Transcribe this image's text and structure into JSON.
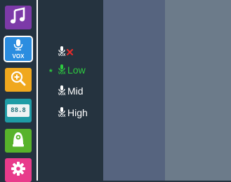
{
  "colors": {
    "sidebar_bg": "#24323f",
    "submenu_bg": "#25333f",
    "panel_mid": "#56647f",
    "panel_right": "#6c7b8a",
    "selected_green": "#2ecc40",
    "mute_red": "#e32b2b"
  },
  "sidebar": {
    "items": [
      {
        "name": "music",
        "icon": "music-note-icon",
        "color": "#7c3aa8"
      },
      {
        "name": "vox",
        "icon": "microphone-icon",
        "label": "VOX",
        "color": "#2b8de0",
        "active": true
      },
      {
        "name": "zoom",
        "icon": "zoom-in-icon",
        "color": "#f0a81e"
      },
      {
        "name": "temperature",
        "icon": "thermometer-display-icon",
        "value": "88.8",
        "color": "#1f9ca6"
      },
      {
        "name": "camera",
        "icon": "baby-camera-icon",
        "color": "#57b32b"
      },
      {
        "name": "settings",
        "icon": "gear-icon",
        "color": "#e83b8b"
      }
    ]
  },
  "vox_menu": {
    "badge": "VOX",
    "options": [
      {
        "level": "off",
        "icon": "mute-x-icon",
        "label": "",
        "selected": false
      },
      {
        "level": "low",
        "label": "Low",
        "selected": true
      },
      {
        "level": "mid",
        "label": "Mid",
        "selected": false
      },
      {
        "level": "high",
        "label": "High",
        "selected": false
      }
    ],
    "selected_marker": "*"
  }
}
